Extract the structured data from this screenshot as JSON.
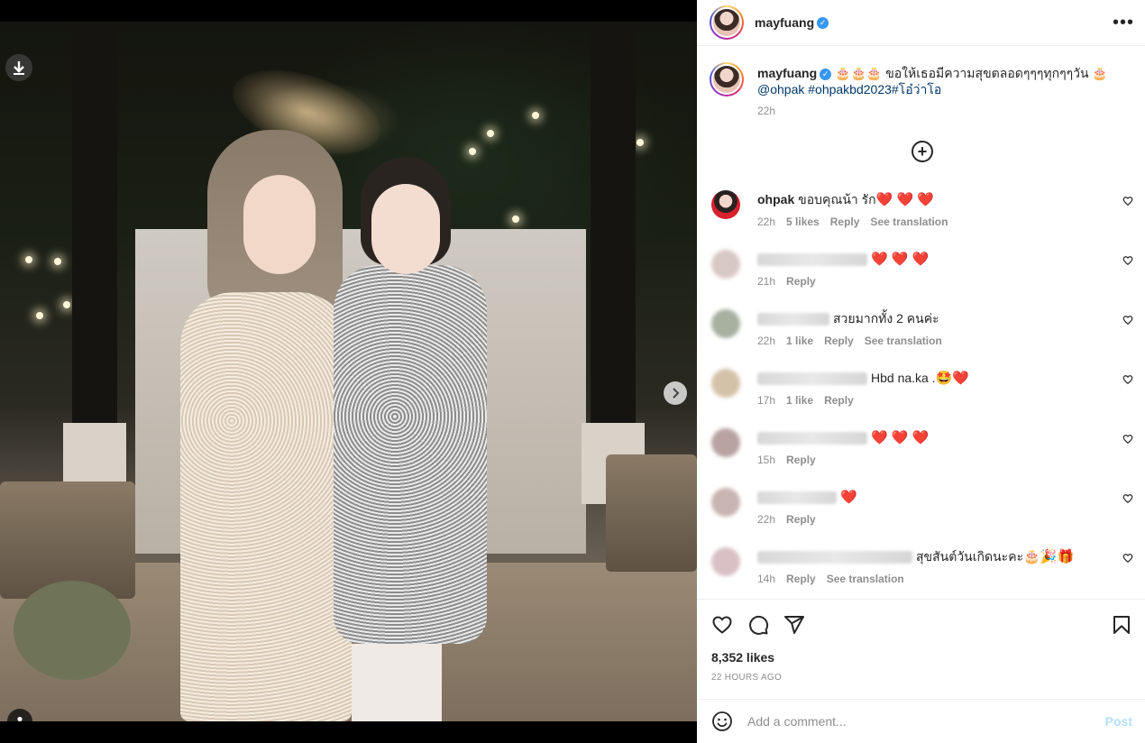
{
  "post": {
    "author": "mayfuang",
    "caption_text": "🎂🎂🎂 ขอให้เธอมีความสุขตลอดๆๆๆทุกๆๆวัน 🎂",
    "caption_mention": "@ohpak",
    "caption_tags": "#ohpakbd2023#โอ๋ว่าโอ",
    "caption_time": "22h",
    "likes": "8,352 likes",
    "posted_ago": "22 HOURS AGO"
  },
  "comments": [
    {
      "user": "ohpak",
      "text": "ขอบคุณน้า รัก",
      "emoji": "❤️ ❤️ ❤️",
      "time": "22h",
      "likes": "5 likes",
      "reply": "Reply",
      "translate": "See translation"
    },
    {
      "user": "",
      "text": "",
      "emoji": "❤️ ❤️ ❤️",
      "time": "21h",
      "likes": "",
      "reply": "Reply",
      "translate": ""
    },
    {
      "user": "",
      "text": "สวยมากทั้ง 2 คนค่ะ",
      "emoji": "",
      "time": "22h",
      "likes": "1 like",
      "reply": "Reply",
      "translate": "See translation"
    },
    {
      "user": "",
      "text": "Hbd na.ka .",
      "emoji": "🤩❤️",
      "time": "17h",
      "likes": "1 like",
      "reply": "Reply",
      "translate": ""
    },
    {
      "user": "",
      "text": "",
      "emoji": "❤️ ❤️ ❤️",
      "time": "15h",
      "likes": "",
      "reply": "Reply",
      "translate": ""
    },
    {
      "user": "",
      "text": "",
      "emoji": "❤️",
      "time": "22h",
      "likes": "",
      "reply": "Reply",
      "translate": ""
    },
    {
      "user": "",
      "text": "สุขสันต์วันเกิดนะคะ",
      "emoji": "🎂🎉🎁",
      "time": "14h",
      "likes": "",
      "reply": "Reply",
      "translate": "See translation"
    }
  ],
  "composer": {
    "placeholder": "Add a comment...",
    "post_label": "Post"
  },
  "icons": {
    "download": "download-icon",
    "next": "chevron-right-icon",
    "user_tag": "user-tag-icon",
    "more": "more-options-icon",
    "load_more": "plus-circle-icon",
    "like": "heart-icon",
    "comment": "comment-icon",
    "share": "share-icon",
    "save": "bookmark-icon",
    "emoji": "emoji-icon"
  },
  "carousel": {
    "total": 5,
    "active": 2
  }
}
